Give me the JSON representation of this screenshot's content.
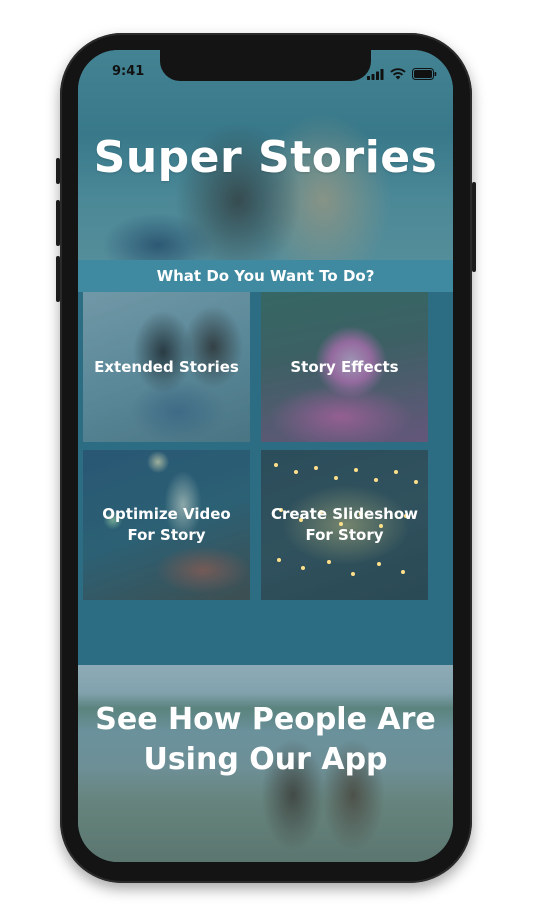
{
  "status_bar": {
    "time": "9:41"
  },
  "hero": {
    "title": "Super Stories"
  },
  "options_section": {
    "heading": "What Do You Want To Do?",
    "tiles": [
      {
        "label": "Extended Stories"
      },
      {
        "label": "Story Effects"
      },
      {
        "label": "Optimize Video For Story"
      },
      {
        "label": "Create Slideshow For Story"
      }
    ]
  },
  "community": {
    "title": "See How People Are Using Our App"
  },
  "colors": {
    "accent": "#2d6d83",
    "band": "#3f8aa0",
    "text": "#ffffff"
  },
  "icons": [
    "signal-icon",
    "wifi-icon",
    "battery-icon"
  ]
}
